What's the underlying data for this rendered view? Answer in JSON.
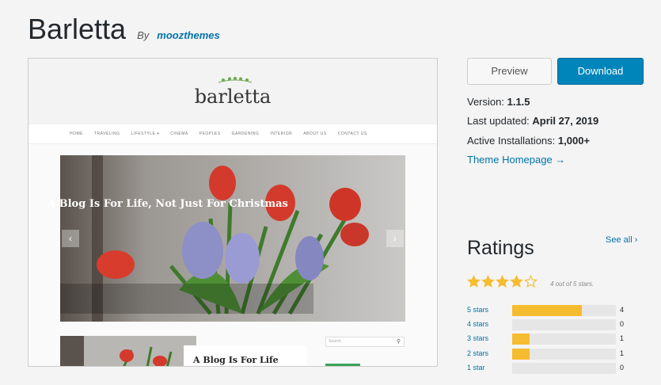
{
  "theme": {
    "name": "Barletta",
    "by_label": "By",
    "author": "moozthemes"
  },
  "preview_image": {
    "logo_text": "barletta",
    "nav_items": [
      "HOME",
      "TRAVELING",
      "LIFESTYLE ▾",
      "CINEMA",
      "PEOPLES",
      "GARDENING",
      "INTERIOR",
      "ABOUT US",
      "CONTACT US"
    ],
    "hero_caption": "A Blog Is For Life, Not Just For Christmas",
    "card_title": "A Blog Is For Life",
    "search_placeholder": "Search",
    "prev_arrow": "‹",
    "next_arrow": "›",
    "search_icon": "search-icon"
  },
  "actions": {
    "preview_label": "Preview",
    "download_label": "Download"
  },
  "meta": {
    "version_label": "Version:",
    "version_value": "1.1.5",
    "updated_label": "Last updated:",
    "updated_value": "April 27, 2019",
    "installs_label": "Active Installations:",
    "installs_value": "1,000+",
    "homepage_label": "Theme Homepage →"
  },
  "ratings": {
    "title": "Ratings",
    "see_all": "See all ›",
    "average": 4,
    "out_of": 5,
    "stars_label": "4 out of 5 stars.",
    "rows": [
      {
        "label": "5 stars",
        "count": "4",
        "fraction": 0.67
      },
      {
        "label": "4 stars",
        "count": "0",
        "fraction": 0
      },
      {
        "label": "3 stars",
        "count": "1",
        "fraction": 0.17
      },
      {
        "label": "2 stars",
        "count": "1",
        "fraction": 0.17
      },
      {
        "label": "1 star",
        "count": "0",
        "fraction": 0
      }
    ]
  },
  "colors": {
    "accent": "#0073aa",
    "download_bg": "#0085ba",
    "star": "#f6bc2f",
    "bar_track": "#e6e6e6"
  }
}
